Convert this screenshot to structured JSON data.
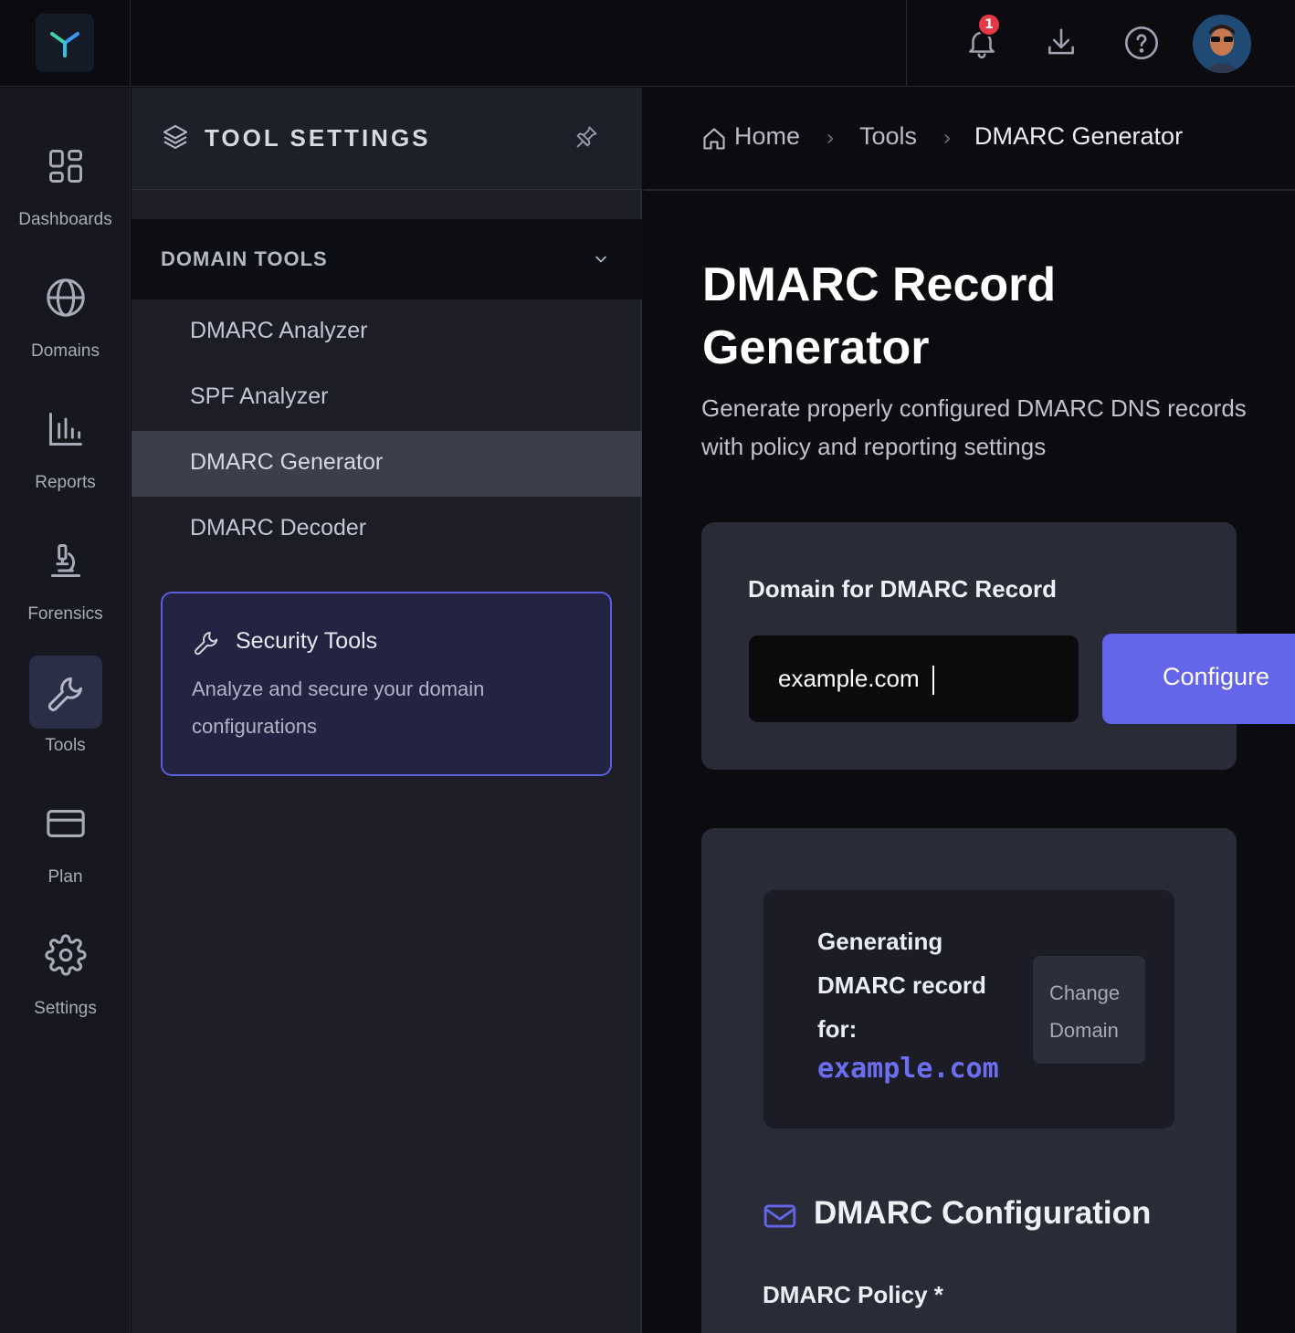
{
  "topbar": {
    "notifications": {
      "count": "1"
    }
  },
  "rail": {
    "items": [
      {
        "label": "Dashboards",
        "icon": "dashboard-icon"
      },
      {
        "label": "Domains",
        "icon": "globe-icon"
      },
      {
        "label": "Reports",
        "icon": "bar-chart-icon"
      },
      {
        "label": "Forensics",
        "icon": "microscope-icon"
      },
      {
        "label": "Tools",
        "icon": "wrench-icon",
        "active": true
      },
      {
        "label": "Plan",
        "icon": "credit-card-icon"
      },
      {
        "label": "Settings",
        "icon": "gear-icon"
      }
    ]
  },
  "panel": {
    "title": "TOOL SETTINGS",
    "section": {
      "title": "DOMAIN TOOLS",
      "items": [
        {
          "label": "DMARC Analyzer"
        },
        {
          "label": "SPF Analyzer"
        },
        {
          "label": "DMARC Generator",
          "active": true
        },
        {
          "label": "DMARC Decoder"
        }
      ]
    },
    "promo": {
      "title": "Security Tools",
      "text": "Analyze and secure your domain configurations"
    }
  },
  "breadcrumb": {
    "home": "Home",
    "tools": "Tools",
    "current": "DMARC Generator"
  },
  "main": {
    "title": "DMARC Record Generator",
    "subtitle": "Generate properly configured DMARC DNS records with policy and reporting settings",
    "domain_card": {
      "label": "Domain for DMARC Record",
      "input_value": "example.com",
      "button": "Configure"
    },
    "generating": {
      "text": "Generating DMARC record for:",
      "domain": "example.com",
      "change_button": "Change Domain"
    },
    "config": {
      "title": "DMARC Configuration",
      "policy_label": "DMARC Policy *"
    }
  },
  "colors": {
    "accent": "#6466e9",
    "background": "#0b0b10",
    "panel": "#1c1d27",
    "card": "#292b36",
    "badge": "#e53945"
  }
}
